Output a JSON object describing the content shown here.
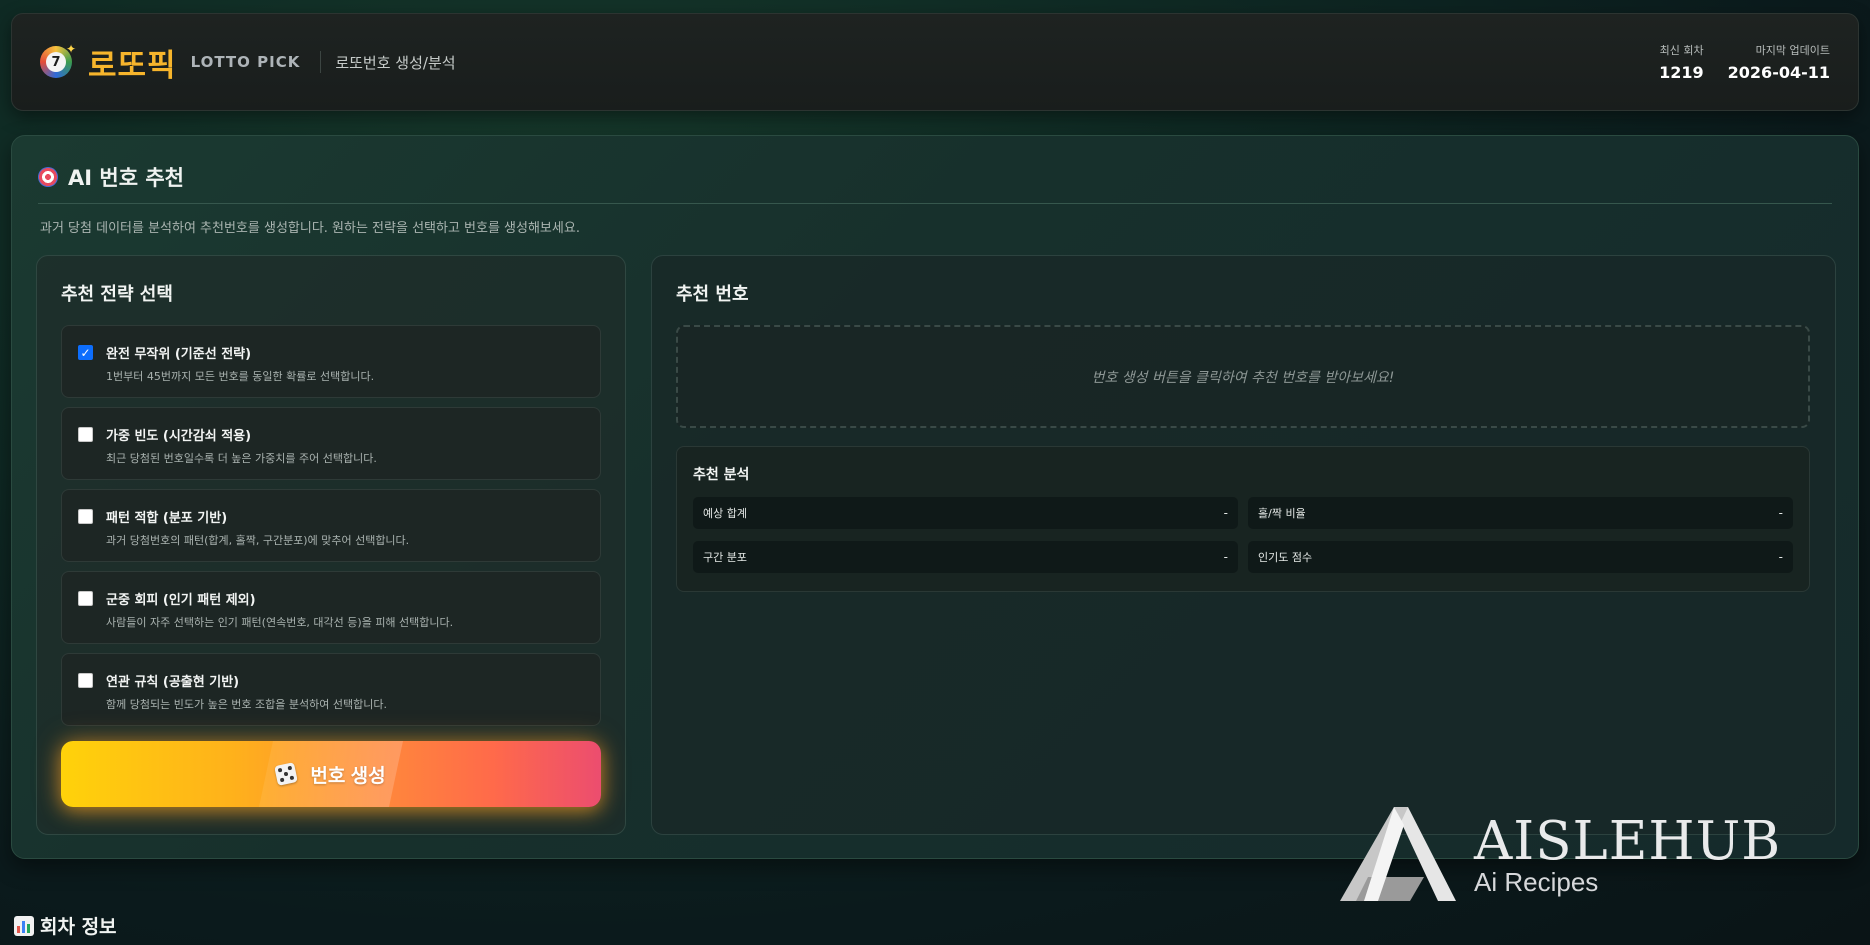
{
  "header": {
    "logo_number": "7",
    "brand_ko": "로또픽",
    "brand_en": "LOTTO PICK",
    "subtitle": "로또번호 생성/분석",
    "stats": [
      {
        "label": "최신 회차",
        "value": "1219"
      },
      {
        "label": "마지막 업데이트",
        "value": "2026-04-11"
      }
    ]
  },
  "main": {
    "title": "AI 번호 추천",
    "description": "과거 당첨 데이터를 분석하여 추천번호를 생성합니다. 원하는 전략을 선택하고 번호를 생성해보세요."
  },
  "strategy": {
    "title": "추천 전략 선택",
    "options": [
      {
        "label": "완전 무작위 (기준선 전략)",
        "desc": "1번부터 45번까지 모든 번호를 동일한 확률로 선택합니다.",
        "checked": true
      },
      {
        "label": "가중 빈도 (시간감쇠 적용)",
        "desc": "최근 당첨된 번호일수록 더 높은 가중치를 주어 선택합니다.",
        "checked": false
      },
      {
        "label": "패턴 적합 (분포 기반)",
        "desc": "과거 당첨번호의 패턴(합계, 홀짝, 구간분포)에 맞추어 선택합니다.",
        "checked": false
      },
      {
        "label": "군중 회피 (인기 패턴 제외)",
        "desc": "사람들이 자주 선택하는 인기 패턴(연속번호, 대각선 등)을 피해 선택합니다.",
        "checked": false
      },
      {
        "label": "연관 규칙 (공출현 기반)",
        "desc": "함께 당첨되는 빈도가 높은 번호 조합을 분석하여 선택합니다.",
        "checked": false
      }
    ],
    "generate_label": "번호 생성"
  },
  "result": {
    "title": "추천 번호",
    "placeholder": "번호 생성 버튼을 클릭하여 추천 번호를 받아보세요!",
    "analysis": {
      "title": "추천 분석",
      "metrics": [
        {
          "label": "예상 합계",
          "value": "-"
        },
        {
          "label": "홀/짝 비율",
          "value": "-"
        },
        {
          "label": "구간 분포",
          "value": "-"
        },
        {
          "label": "인기도 점수",
          "value": "-"
        }
      ]
    }
  },
  "footer": {
    "title": "회차 정보"
  },
  "watermark": {
    "name": "AISLEHUB",
    "sub": "Ai Recipes"
  },
  "colors": {
    "brand_accent": "#f7b52c",
    "checkbox_checked": "#0d6efd",
    "button_gradient_start": "#ffd20a",
    "button_gradient_end": "#ec4d6f"
  },
  "icons": {
    "logo": "lotto-ball-icon",
    "title": "target-icon",
    "button": "dice-icon",
    "footer": "bar-chart-icon"
  }
}
